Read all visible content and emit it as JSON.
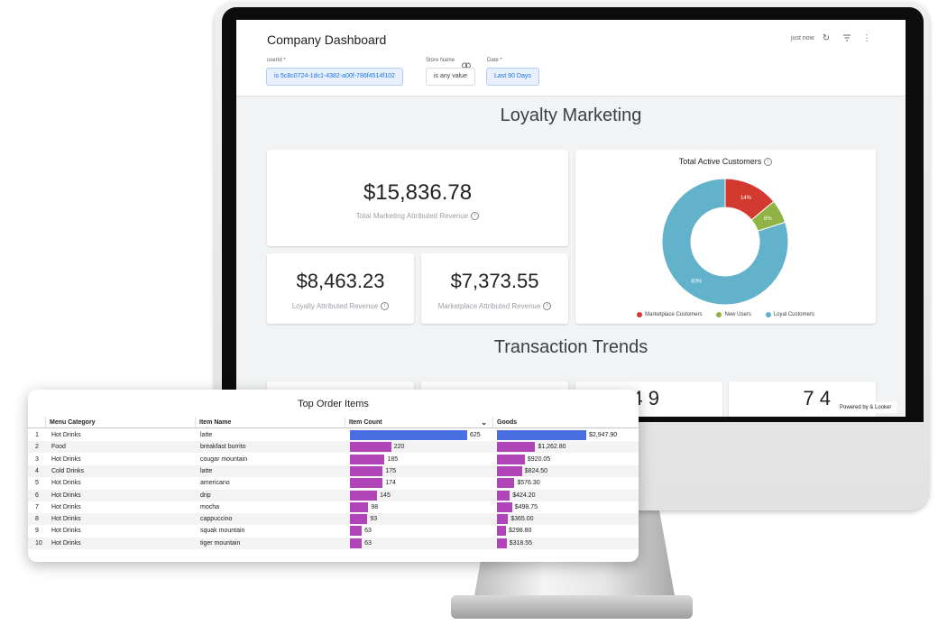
{
  "dashboard": {
    "title": "Company Dashboard",
    "last_refresh": "just now",
    "powered_by": "Powered by & Looker"
  },
  "filters": {
    "userid": {
      "label": "userId *",
      "value": "is 5c8c0724-1dc1-4382-a00f-786f4514f102"
    },
    "store": {
      "label": "Store Name",
      "value": "is any value"
    },
    "date": {
      "label": "Date *",
      "value": "Last 90 Days"
    }
  },
  "loyalty": {
    "section_title": "Loyalty Marketing",
    "total_value": "$15,836.78",
    "total_label": "Total Marketing Attributed Revenue",
    "loyalty_value": "$8,463.23",
    "loyalty_label": "Loyalty Attributed Revenue",
    "marketplace_value": "$7,373.55",
    "marketplace_label": "Marketplace Attributed Revenue"
  },
  "transaction": {
    "section_title": "Transaction Trends",
    "partial_value_1": "4 9",
    "partial_value_2": "7 4"
  },
  "chart_data": {
    "type": "pie",
    "title": "Total Active Customers",
    "categories": [
      "Marketplace Customers",
      "New Users",
      "Loyal Customers"
    ],
    "values": [
      14,
      6,
      80
    ],
    "labels": [
      "14%",
      "6%",
      "80%"
    ],
    "colors": [
      "#d23a2f",
      "#8fb445",
      "#62b2cb"
    ],
    "legend": "bottom"
  },
  "top_items": {
    "title": "Top Order Items",
    "columns": [
      "Menu Category",
      "Item Name",
      "Item Count",
      "Goods"
    ],
    "sort_icon": "chevron-down-icon",
    "max_count": 625,
    "max_goods": 2947.9,
    "rows": [
      {
        "n": "1",
        "category": "Hot Drinks",
        "item": "latte",
        "count": 625,
        "goods": 2947.9,
        "count_label": "625",
        "goods_label": "$2,947.90"
      },
      {
        "n": "2",
        "category": "Food",
        "item": "breakfast burrito",
        "count": 220,
        "goods": 1262.8,
        "count_label": "220",
        "goods_label": "$1,262.80"
      },
      {
        "n": "3",
        "category": "Hot Drinks",
        "item": "cougar mountain",
        "count": 185,
        "goods": 920.05,
        "count_label": "185",
        "goods_label": "$920.05"
      },
      {
        "n": "4",
        "category": "Cold Drinks",
        "item": "latte",
        "count": 175,
        "goods": 824.5,
        "count_label": "175",
        "goods_label": "$824.50"
      },
      {
        "n": "5",
        "category": "Hot Drinks",
        "item": "americano",
        "count": 174,
        "goods": 576.3,
        "count_label": "174",
        "goods_label": "$576.30"
      },
      {
        "n": "6",
        "category": "Hot Drinks",
        "item": "drip",
        "count": 145,
        "goods": 424.2,
        "count_label": "145",
        "goods_label": "$424.20"
      },
      {
        "n": "7",
        "category": "Hot Drinks",
        "item": "mocha",
        "count": 98,
        "goods": 498.75,
        "count_label": "98",
        "goods_label": "$498.75"
      },
      {
        "n": "8",
        "category": "Hot Drinks",
        "item": "cappuccino",
        "count": 93,
        "goods": 365.0,
        "count_label": "93",
        "goods_label": "$365.00"
      },
      {
        "n": "9",
        "category": "Hot Drinks",
        "item": "squak mountain",
        "count": 63,
        "goods": 298.8,
        "count_label": "63",
        "goods_label": "$298.80"
      },
      {
        "n": "10",
        "category": "Hot Drinks",
        "item": "tiger mountain",
        "count": 63,
        "goods": 318.55,
        "count_label": "63",
        "goods_label": "$318.55"
      }
    ],
    "colors": {
      "top": "#4a6fe3",
      "bar": "#b044b8"
    }
  }
}
